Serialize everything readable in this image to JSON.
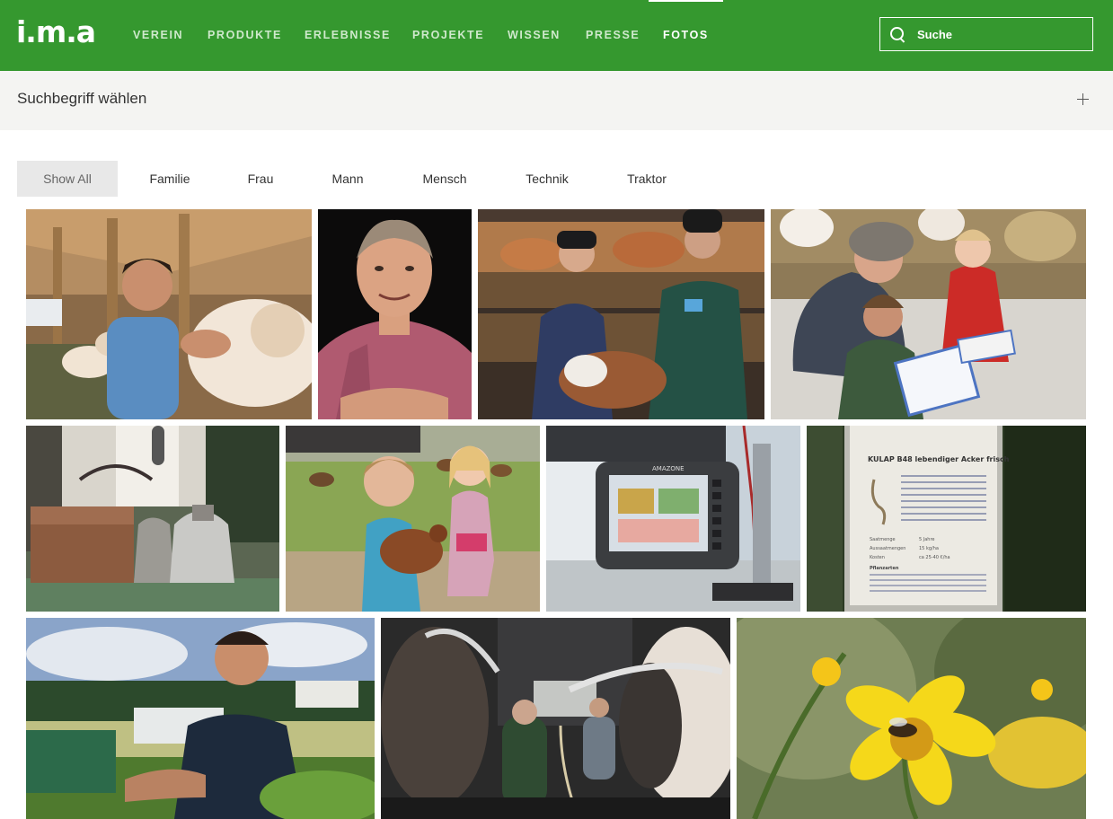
{
  "logo": "i.m.a",
  "nav": [
    {
      "label": "VEREIN"
    },
    {
      "label": "PRODUKTE"
    },
    {
      "label": "ERLEBNISSE"
    },
    {
      "label": "PROJEKTE"
    },
    {
      "label": "WISSEN"
    },
    {
      "label": "PRESSE"
    },
    {
      "label": "FOTOS",
      "active": true
    }
  ],
  "search": {
    "placeholder": "Suche"
  },
  "filter": {
    "label": "Suchbegriff wählen"
  },
  "tags": [
    "Show All",
    "Familie",
    "Frau",
    "Mann",
    "Mensch",
    "Technik",
    "Traktor"
  ],
  "sign": {
    "title": "KULAP B48 lebendiger Acker frisch",
    "labels": [
      "Saatmenge",
      "Aussaatmengen",
      "Kosten"
    ],
    "values": [
      "5 Jahre",
      "15 kg/ha",
      "ca 25-40 €/ha"
    ],
    "heading": "Pflanzarten"
  },
  "terminal_brand": "AMAZONE",
  "colors": {
    "brand_green": "#35982f",
    "tag_active_bg": "#e8e8e8"
  }
}
